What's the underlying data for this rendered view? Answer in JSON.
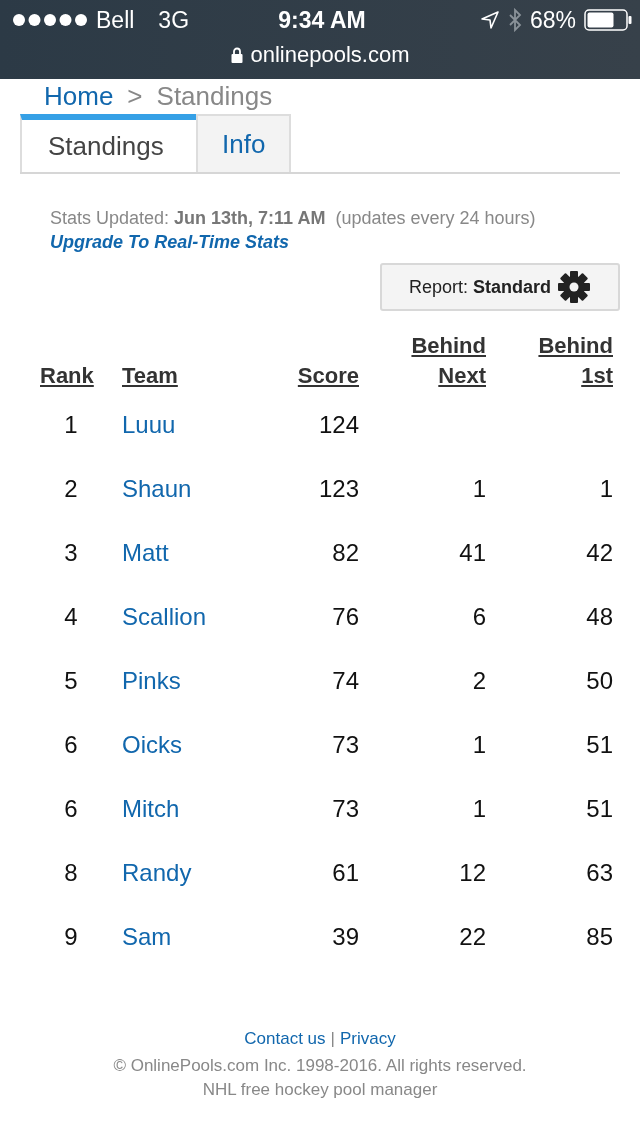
{
  "status_bar": {
    "carrier": "Bell",
    "network": "3G",
    "time": "9:34 AM",
    "battery": "68%"
  },
  "address_bar": {
    "url": "onlinepools.com"
  },
  "breadcrumb": [
    {
      "label": "Home",
      "kind": "link"
    },
    {
      "label": ">",
      "kind": "separator"
    },
    {
      "label": "Standings",
      "kind": "current"
    }
  ],
  "tabs": [
    {
      "label": "Standings",
      "selected": true
    },
    {
      "label": "Info",
      "selected": false
    }
  ],
  "stats": {
    "text": "Stats Updated: **Jun 13th, 7:11 AM**  (updates every 24 hours)",
    "upgrade_link": "Upgrade To Real-Time Stats"
  },
  "report_button": {
    "label": "Report: **Standard**"
  },
  "table": {
    "columns": [
      {
        "label": "Rank"
      },
      {
        "label": "Team"
      },
      {
        "label": "Score"
      },
      {
        "label": "Behind Next"
      },
      {
        "label": "Behind 1st"
      }
    ],
    "rows": [
      {
        "rank": "1",
        "team": "Luuu",
        "score": "124"
      },
      {
        "rank": "2",
        "team": "Shaun",
        "score": "123",
        "behind_next": "1",
        "behind_first": "1"
      },
      {
        "rank": "3",
        "team": "Matt",
        "score": "82",
        "behind_next": "41",
        "behind_first": "42"
      },
      {
        "rank": "4",
        "team": "Scallion",
        "score": "76",
        "behind_next": "6",
        "behind_first": "48"
      },
      {
        "rank": "5",
        "team": "Pinks",
        "score": "74",
        "behind_next": "2",
        "behind_first": "50"
      },
      {
        "rank": "6",
        "team": "Oicks",
        "score": "73",
        "behind_next": "1",
        "behind_first": "51"
      },
      {
        "rank": "6",
        "team": "Mitch",
        "score": "73",
        "behind_next": "1",
        "behind_first": "51"
      },
      {
        "rank": "8",
        "team": "Randy",
        "score": "61",
        "behind_next": "12",
        "behind_first": "63"
      },
      {
        "rank": "9",
        "team": "Sam",
        "score": "39",
        "behind_next": "22",
        "behind_first": "85"
      }
    ]
  },
  "footer": {
    "links": [
      "Contact us",
      "Privacy"
    ],
    "separator": "|",
    "copyright": "© OnlinePools.com Inc. 1998-2016. All rights reserved.",
    "tagline": "NHL free hockey pool manager"
  }
}
